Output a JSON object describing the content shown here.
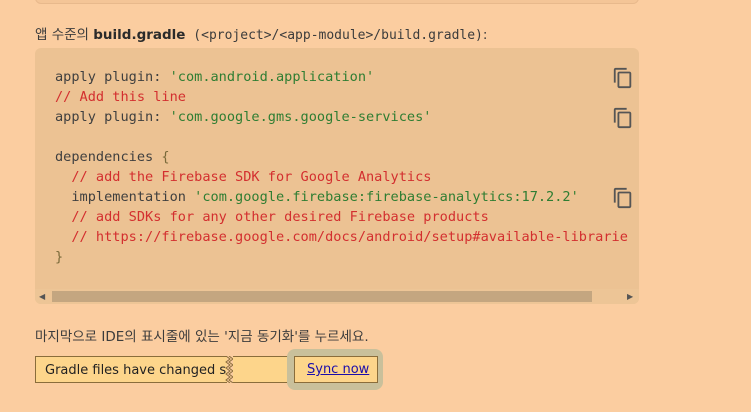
{
  "intro": {
    "prefix": "앱 수준의 ",
    "file_bold": "build.gradle",
    "path_code": " (<project>/<app-module>/build.gradle)",
    "suffix": ":"
  },
  "code": {
    "line1_kw": "apply plugin: ",
    "line1_str": "'com.android.application'",
    "line2_cmt": "// Add this line",
    "line3_kw": "apply plugin: ",
    "line3_str": "'com.google.gms.google-services'",
    "line5_kw": "dependencies ",
    "line5_brace": "{",
    "line6_cmt": "  // add the Firebase SDK for Google Analytics",
    "line7_kw": "  implementation ",
    "line7_str": "'com.google.firebase:firebase-analytics:17.2.2'",
    "line8_cmt": "  // add SDKs for any other desired Firebase products",
    "line9_cmt": "  // https://firebase.google.com/docs/android/setup#available-librarie",
    "line10_brace": "}"
  },
  "icons": {
    "copy": "copy-icon",
    "scroll_left": "chevron-left-icon",
    "scroll_right": "chevron-right-icon"
  },
  "instruction": "마지막으로 IDE의 표시줄에 있는 '지금 동기화'를 누르세요.",
  "notification": {
    "message": "Gradle files have changed si",
    "sync_label": "Sync now"
  },
  "colors": {
    "page_bg": "#fbcda0",
    "code_bg": "#ecc293",
    "string": "#2e7d32",
    "comment": "#d32f2f",
    "bar_bg": "#fdd58b"
  }
}
